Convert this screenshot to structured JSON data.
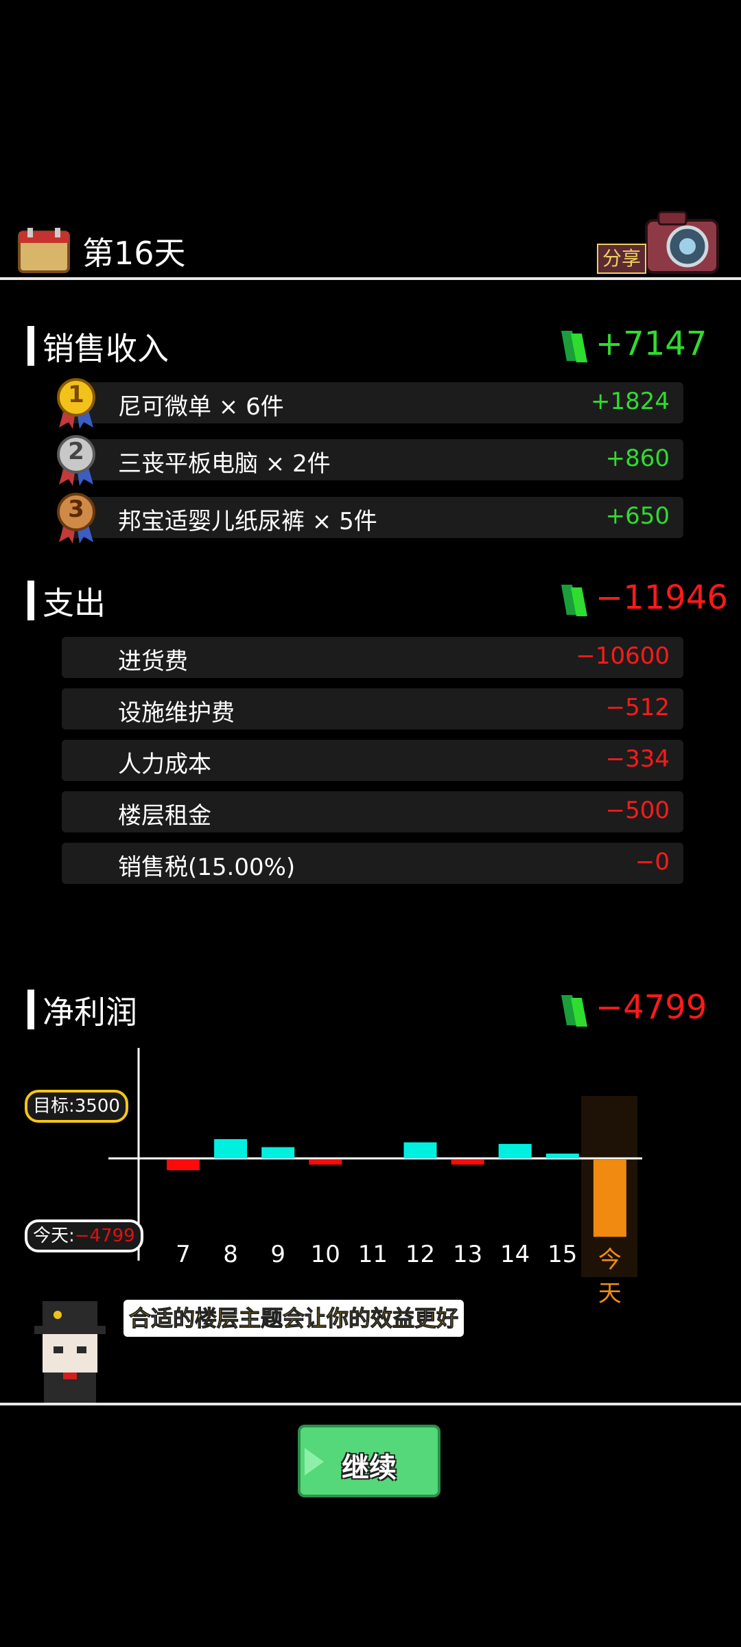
{
  "header": {
    "day_title": "第16天",
    "share_label": "分享"
  },
  "sales": {
    "title": "销售收入",
    "total": "+7147",
    "items": [
      {
        "rank": "1",
        "label": "尼可微单 × 6件",
        "value": "+1824"
      },
      {
        "rank": "2",
        "label": "三丧平板电脑 × 2件",
        "value": "+860"
      },
      {
        "rank": "3",
        "label": "邦宝适婴儿纸尿裤 × 5件",
        "value": "+650"
      }
    ]
  },
  "expense": {
    "title": "支出",
    "total": "−11946",
    "items": [
      {
        "label": "进货费",
        "value": "−10600"
      },
      {
        "label": "设施维护费",
        "value": "−512"
      },
      {
        "label": "人力成本",
        "value": "−334"
      },
      {
        "label": "楼层租金",
        "value": "−500"
      },
      {
        "label": "销售税(15.00%)",
        "value": "−0"
      }
    ]
  },
  "profit": {
    "title": "净利润",
    "total": "−4799",
    "target_label": "目标:3500",
    "today_label": "今天:",
    "today_value": "−4799"
  },
  "chart_data": {
    "type": "bar",
    "categories": [
      "7",
      "8",
      "9",
      "10",
      "11",
      "12",
      "13",
      "14",
      "15",
      "今天"
    ],
    "values": [
      -650,
      1200,
      700,
      -300,
      0,
      1000,
      -300,
      900,
      300,
      -4799
    ],
    "colors": {
      "positive": "#00f0e0",
      "negative": "#ff0a0a",
      "today": "#f08a10"
    }
  },
  "tip": {
    "text": "合适的楼层主题会让你的效益更好"
  },
  "footer": {
    "continue_label": "继续"
  }
}
